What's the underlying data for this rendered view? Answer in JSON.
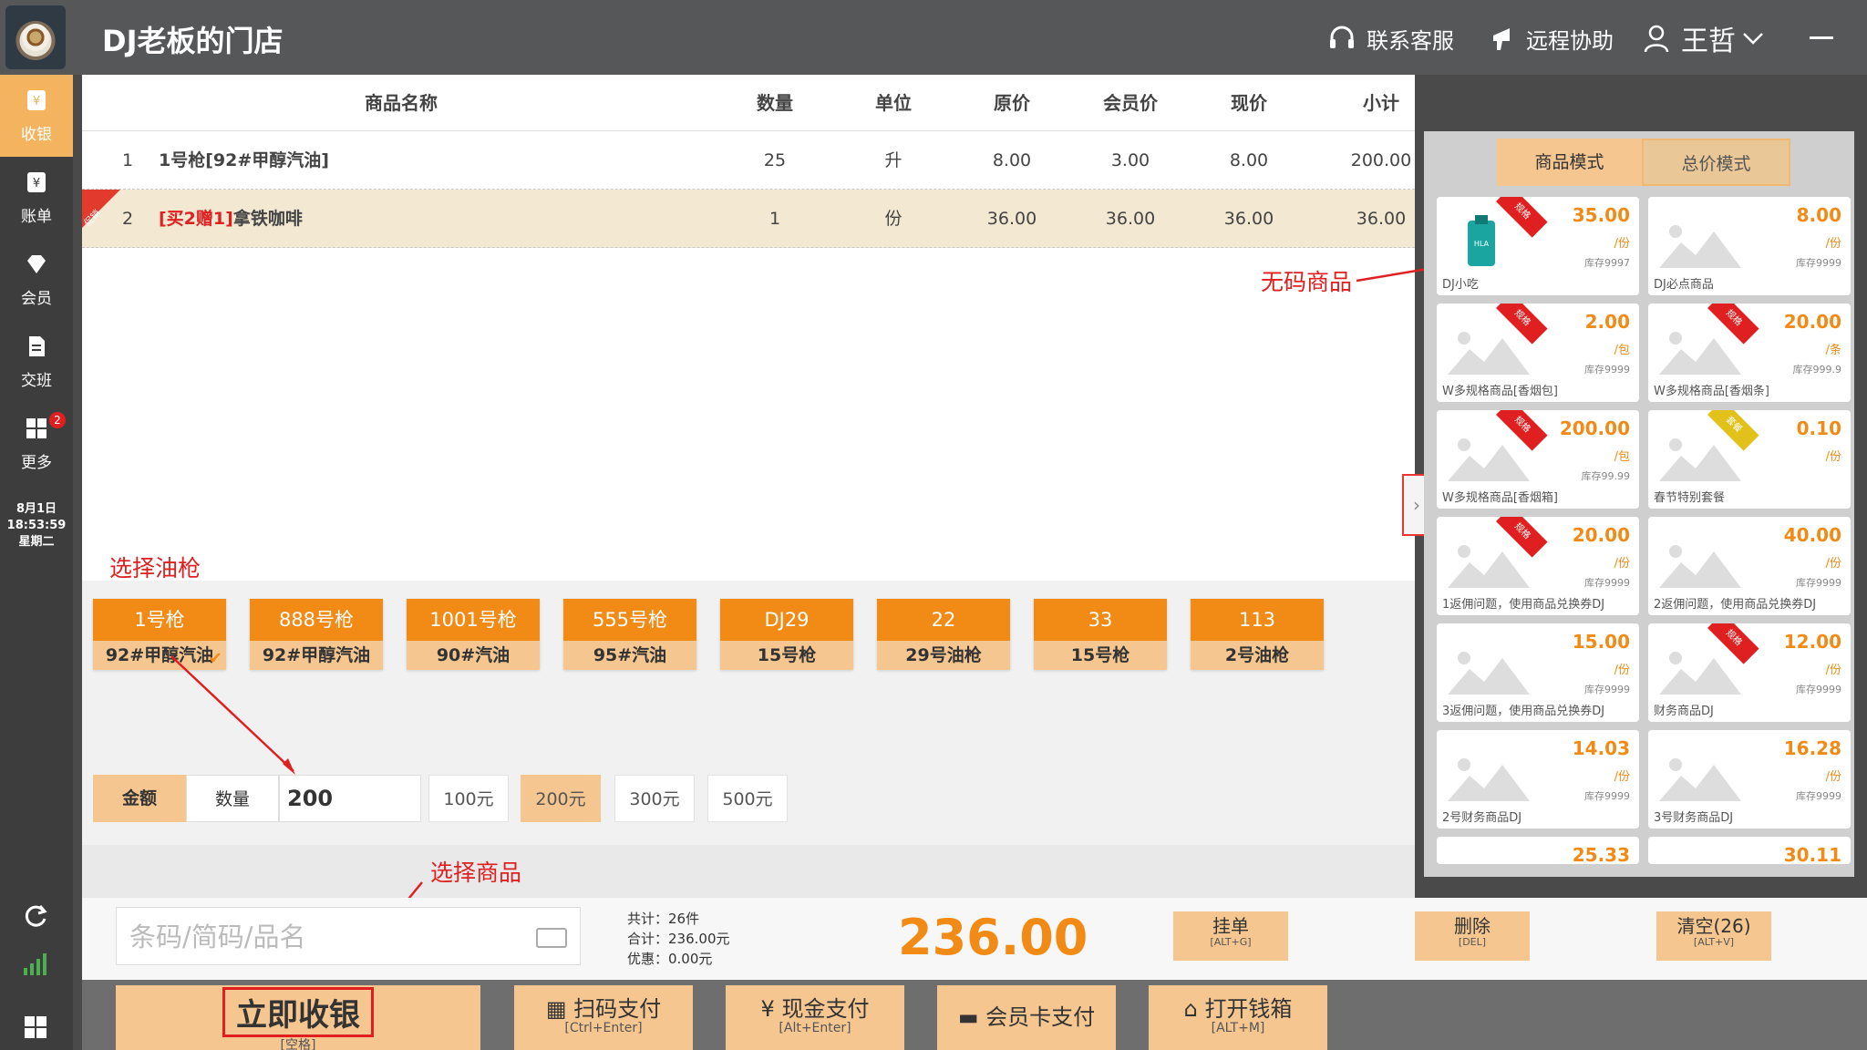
{
  "header": {
    "store_name": "DJ老板的门店",
    "service": "联系客服",
    "remote": "远程协助",
    "user": "王哲"
  },
  "sidebar": {
    "items": [
      {
        "label": "收银"
      },
      {
        "label": "账单"
      },
      {
        "label": "会员"
      },
      {
        "label": "交班"
      },
      {
        "label": "更多",
        "badge": "2"
      }
    ],
    "date": "8月1日",
    "time": "18:53:59",
    "weekday": "星期二"
  },
  "table": {
    "headers": [
      "商品名称",
      "数量",
      "单位",
      "原价",
      "会员价",
      "现价",
      "小计"
    ],
    "rows": [
      {
        "idx": "1",
        "name": "1号枪[92#甲醇汽油]",
        "qty": "25",
        "unit": "升",
        "orig": "8.00",
        "member": "3.00",
        "current": "8.00",
        "subtotal": "200.00"
      },
      {
        "idx": "2",
        "promo": "[买2赠1]",
        "name": "拿铁咖啡",
        "qty": "1",
        "unit": "份",
        "orig": "36.00",
        "member": "36.00",
        "current": "36.00",
        "subtotal": "36.00",
        "corner": "促销"
      }
    ]
  },
  "annotations": {
    "select_gun": "选择油枪",
    "select_product": "选择商品",
    "no_code": "无码商品"
  },
  "guns": [
    {
      "name": "1号枪",
      "fuel": "92#甲醇汽油"
    },
    {
      "name": "888号枪",
      "fuel": "92#甲醇汽油"
    },
    {
      "name": "1001号枪",
      "fuel": "90#汽油"
    },
    {
      "name": "555号枪",
      "fuel": "95#汽油"
    },
    {
      "name": "DJ29",
      "fuel": "15号枪"
    },
    {
      "name": "22",
      "fuel": "29号油枪"
    },
    {
      "name": "33",
      "fuel": "15号枪"
    },
    {
      "name": "113",
      "fuel": "2号油枪"
    }
  ],
  "amount": {
    "tab_amount": "金额",
    "tab_qty": "数量",
    "value": "200",
    "quick": [
      "100元",
      "200元",
      "300元",
      "500元"
    ]
  },
  "mode_tabs": [
    "商品模式",
    "总价模式"
  ],
  "products": [
    {
      "name": "DJ小吃",
      "price": "35.00",
      "unit": "/份",
      "stock": "库存9997",
      "tag": "规格"
    },
    {
      "name": "DJ必点商品",
      "price": "8.00",
      "unit": "/份",
      "stock": "库存9999",
      "tag": ""
    },
    {
      "name": "W多规格商品[香烟包]",
      "price": "2.00",
      "unit": "/包",
      "stock": "库存9999",
      "tag": "规格"
    },
    {
      "name": "W多规格商品[香烟条]",
      "price": "20.00",
      "unit": "/条",
      "stock": "库存999.9",
      "tag": "规格"
    },
    {
      "name": "W多规格商品[香烟箱]",
      "price": "200.00",
      "unit": "/包",
      "stock": "库存99.99",
      "tag": "规格"
    },
    {
      "name": "春节特别套餐",
      "price": "0.10",
      "unit": "/份",
      "stock": "",
      "tag": "套餐"
    },
    {
      "name": "1返佣问题，使用商品兑换券DJ",
      "price": "20.00",
      "unit": "/份",
      "stock": "库存9999",
      "tag": "规格"
    },
    {
      "name": "2返佣问题，使用商品兑换券DJ",
      "price": "40.00",
      "unit": "/份",
      "stock": "库存9999",
      "tag": ""
    },
    {
      "name": "3返佣问题，使用商品兑换券DJ",
      "price": "15.00",
      "unit": "/份",
      "stock": "库存9999",
      "tag": ""
    },
    {
      "name": "财务商品DJ",
      "price": "12.00",
      "unit": "/份",
      "stock": "库存9999",
      "tag": "规格"
    },
    {
      "name": "2号财务商品DJ",
      "price": "14.03",
      "unit": "/份",
      "stock": "库存9999",
      "tag": ""
    },
    {
      "name": "3号财务商品DJ",
      "price": "16.28",
      "unit": "/份",
      "stock": "库存9999",
      "tag": ""
    },
    {
      "name": "",
      "price": "25.33",
      "unit": "",
      "stock": "",
      "tag": ""
    },
    {
      "name": "",
      "price": "30.11",
      "unit": "",
      "stock": "",
      "tag": ""
    }
  ],
  "bottom": {
    "search_placeholder": "条码/简码/品名",
    "count": "共计：26件",
    "total": "合计：236.00元",
    "discount": "优惠：0.00元",
    "big_total": "236.00",
    "hold": {
      "label": "挂单",
      "key": "[ALT+G]"
    },
    "delete": {
      "label": "删除",
      "key": "[DEL]"
    },
    "clear": {
      "label": "清空(26)",
      "key": "[ALT+V]"
    },
    "pay_now": {
      "label": "立即收银",
      "key": "[空格]"
    },
    "scan": {
      "label": "扫码支付",
      "key": "[Ctrl+Enter]"
    },
    "cash": {
      "label": "现金支付",
      "key": "[Alt+Enter]"
    },
    "card": {
      "label": "会员卡支付",
      "key": ""
    },
    "drawer": {
      "label": "打开钱箱",
      "key": "[ALT+M]"
    }
  }
}
